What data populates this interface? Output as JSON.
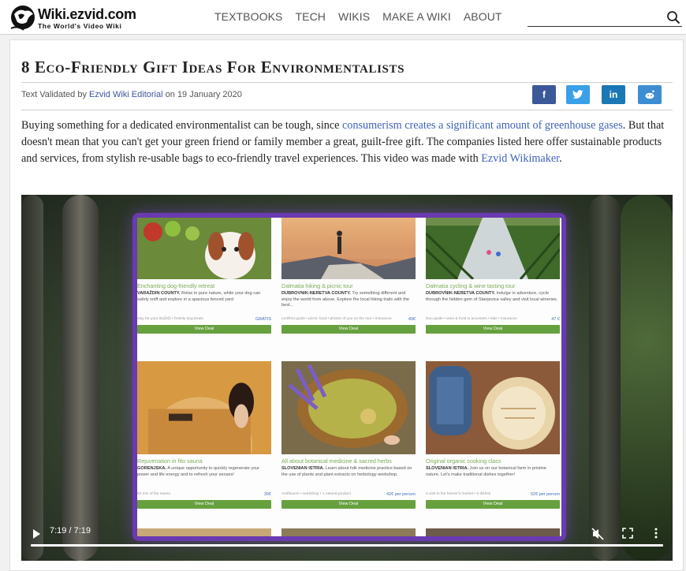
{
  "header": {
    "logo_title": "Wiki.ezvid.com",
    "logo_tagline": "The World's Video Wiki",
    "nav": [
      "TEXTBOOKS",
      "TECH",
      "WIKIS",
      "MAKE A WIKI",
      "ABOUT"
    ],
    "search_placeholder": ""
  },
  "article": {
    "title": "8 Eco-Friendly Gift Ideas For Environmentalists",
    "meta_prefix": "Text Validated by",
    "meta_author": "Ezvid Wiki Editorial",
    "meta_date_prefix": "on",
    "meta_date": "19 January 2020",
    "share": [
      "f",
      "t",
      "in",
      "r"
    ],
    "intro_1": "Buying something for a dedicated environmentalist can be tough, since",
    "intro_link_1": "consumerism creates a significant amount of greenhouse gases",
    "intro_2": ". But that doesn't mean that you can't get your green friend or family member a great, guilt-free gift. The companies listed here offer sustainable products and services, from stylish re-usable bags to eco-friendly travel experiences. This video was made with",
    "intro_link_2": "Ezvid Wikimaker",
    "intro_3": "."
  },
  "video": {
    "time": "7:19 / 7:19",
    "progress": 1.0,
    "tiles": [
      {
        "caption": "Enchanting dog-friendly retreat",
        "place": "VARAŽDIN COUNTY.",
        "text": "Relax in pure nature, while your dog can safely sniff and explore in a spacious fenced yard",
        "foot": "stay for your do@@ • freshly dog treats",
        "price": "GRATIS",
        "button": "View Deal"
      },
      {
        "caption": "Dalmatia hiking & picnic tour",
        "place": "DUBROVNIK-NERETVA COUNTY.",
        "text": "Try something different and enjoy the world from above. Explore the local hiking trails with the best...",
        "foot": "certified guide • picnic food • photos of you on the tour • insurance",
        "price": "49€",
        "button": "View Deal"
      },
      {
        "caption": "Dalmatia cycling & wine tasting tour",
        "place": "DUBROVNIK-NERETVA COUNTY.",
        "text": "Indulge in adventure, cycle through the hidden gem of Stanjevica valley and visit local wineries.",
        "foot": "Duo guide • wine & food in accesses • bike • insurance",
        "price": "47 €",
        "button": "View Deal"
      },
      {
        "caption": "Rejuvenation in fito sauna",
        "place": "GORENJSKA.",
        "text": "A unique opportunity to quickly regenerate your power and life energy and to refresh your senses!",
        "foot": "60 min of fito sauna",
        "price": "30€",
        "button": "View Deal"
      },
      {
        "caption": "All about botanical medicine & sacred herbs",
        "place": "SLOVENIAN ISTRIA.",
        "text": "Learn about folk medicine practice based on the use of plants and plant extracts on herbology workshop.",
        "foot": "Antifauxon • workshop • 1 natural product",
        "price": "42€ per person",
        "button": "View Deal"
      },
      {
        "caption": "Original organic cooking class",
        "place": "SLOVENIAN ISTRIA.",
        "text": "Join us on our botanical farm in pristine nature. Let's make traditional dishes together!",
        "foot": "a visit to the farmer's market • 5 dishes",
        "price": "52€ per person",
        "button": "View Deal"
      }
    ]
  },
  "colors": {
    "link": "#3f62b8",
    "frame_border": "#6a3ab0",
    "deal_button": "#67a13f",
    "facebook": "#3b5998",
    "twitter": "#3aa0e8",
    "linkedin": "#1a78b5",
    "reddit": "#3d8dd2"
  },
  "icons": {
    "search": "search-icon",
    "play": "play-icon",
    "mute": "volume-muted-icon",
    "fullscreen": "fullscreen-icon",
    "more": "more-vertical-icon"
  }
}
